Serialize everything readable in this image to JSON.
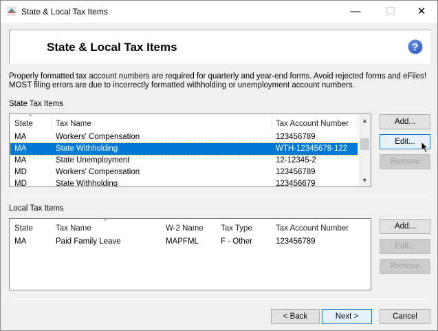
{
  "window": {
    "title": "State & Local Tax Items",
    "minimize": "—",
    "maximize": "☐",
    "close": "✕"
  },
  "header": {
    "title": "State & Local Tax Items",
    "help": "?"
  },
  "info": "Properly formatted tax account numbers are required for quarterly and year-end forms. Avoid rejected forms and eFiles! MOST filing errors are due to incorrectly formatted withholding or unemployment account numbers.",
  "state": {
    "label": "State Tax Items",
    "columns": [
      "State",
      "Tax Name",
      "Tax Account Number"
    ],
    "rows": [
      [
        "MA",
        "Workers' Compensation",
        "123456789"
      ],
      [
        "MA",
        "State Withholding",
        "WTH-12345678-122"
      ],
      [
        "MA",
        "State Unemployment",
        "12-12345-2"
      ],
      [
        "MD",
        "Workers' Compensation",
        "123456789"
      ],
      [
        "MD",
        "State Withholding",
        "123456679"
      ]
    ],
    "selected_index": 1,
    "buttons": {
      "add": "Add...",
      "edit": "Edit...",
      "remove": "Remove"
    }
  },
  "local": {
    "label": "Local Tax Items",
    "columns": [
      "State",
      "Tax Name",
      "W-2 Name",
      "Tax Type",
      "Tax Account Number"
    ],
    "rows": [
      [
        "MA",
        "Paid Family Leave",
        "MAPFML",
        "F - Other",
        "123456789"
      ]
    ],
    "buttons": {
      "add": "Add...",
      "edit": "Edit...",
      "remove": "Remove"
    }
  },
  "footer": {
    "back": "< Back",
    "next": "Next >",
    "cancel": "Cancel"
  }
}
